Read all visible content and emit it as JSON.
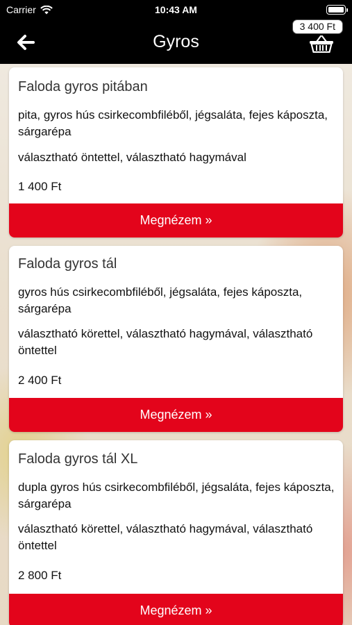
{
  "status_bar": {
    "carrier": "Carrier",
    "time": "10:43 AM",
    "wifi_icon": "wifi-icon",
    "battery_icon": "battery-icon",
    "battery_level": 1.0
  },
  "nav": {
    "title": "Gyros",
    "back_icon": "arrow-left-icon",
    "cart_total": "3 400 Ft",
    "basket_icon": "basket-icon"
  },
  "colors": {
    "nav_background": "#000000",
    "button_red": "#e3041b",
    "card_background": "#ffffff"
  },
  "products": [
    {
      "title": "Faloda gyros pitában",
      "description": "pita, gyros hús csirkecombfiléből, jégsaláta, fejes káposzta, sárgarépa",
      "options": "választható öntettel, választható hagymával",
      "price": "1 400 Ft",
      "button_label": "Megnézem »"
    },
    {
      "title": "Faloda gyros tál",
      "description": "gyros hús csirkecombfiléből, jégsaláta, fejes káposzta, sárgarépa",
      "options": "választható körettel, választható hagymával, választható öntettel",
      "price": "2 400 Ft",
      "button_label": "Megnézem »"
    },
    {
      "title": "Faloda gyros tál XL",
      "description": "dupla gyros hús csirkecombfiléből, jégsaláta, fejes káposzta, sárgarépa",
      "options": "választható körettel, választható hagymával, választható öntettel",
      "price": "2 800 Ft",
      "button_label": "Megnézem »"
    }
  ]
}
